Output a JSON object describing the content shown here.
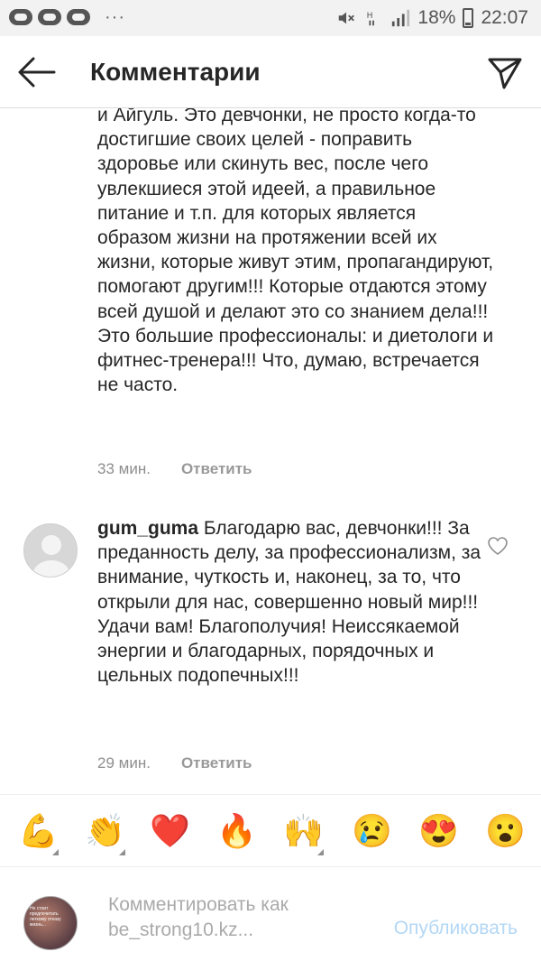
{
  "status_bar": {
    "battery_percent": "18%",
    "time": "22:07",
    "dots": "···",
    "icons": [
      "notification-pill-icon",
      "notification-pill-icon",
      "notification-pill-icon",
      "mute-icon",
      "h-network-icon",
      "signal-icon",
      "battery-icon"
    ]
  },
  "header": {
    "title": "Комментарии",
    "back_icon": "arrow-left-icon",
    "send_icon": "paper-plane-icon"
  },
  "comments": [
    {
      "text": "и Айгуль. Это девчонки, не просто когда-то достигшие своих целей - поправить здоровье или скинуть вес, после чего увлекшиеся этой идеей, а правильное питание и т.п. для которых является образом жизни на протяжении всей их жизни, которые живут этим, пропагандируют, помогают другим!!! Которые отдаются этому всей душой и делают это со знанием дела!!! Это большие профессионалы: и диетологи и фитнес-тренера!!! Что, думаю, встречается не часто.",
      "time": "33 мин.",
      "reply": "Ответить"
    },
    {
      "username": "gum_guma",
      "text": "Благодарю вас, девчонки!!! За преданность делу, за профессионализм, за внимание, чуткость и, наконец, за то, что открыли для нас, совершенно новый мир!!! Удачи вам! Благополучия! Неиссякаемой энергии и благодарных, порядочных и цельных подопечных!!!",
      "time": "29 мин.",
      "reply": "Ответить"
    }
  ],
  "emoji_bar": [
    "💪",
    "👏",
    "❤️",
    "🔥",
    "🙌",
    "😢",
    "😍",
    "😮"
  ],
  "composer": {
    "placeholder": "Комментировать как be_strong10.kz...",
    "publish": "Опубликовать",
    "avatar_text": "Не стоит предпочитать легкому отказу жизнь..."
  },
  "colors": {
    "accent_disabled": "#b3d7f5",
    "meta_gray": "#8e8e8e",
    "text": "#262626"
  }
}
